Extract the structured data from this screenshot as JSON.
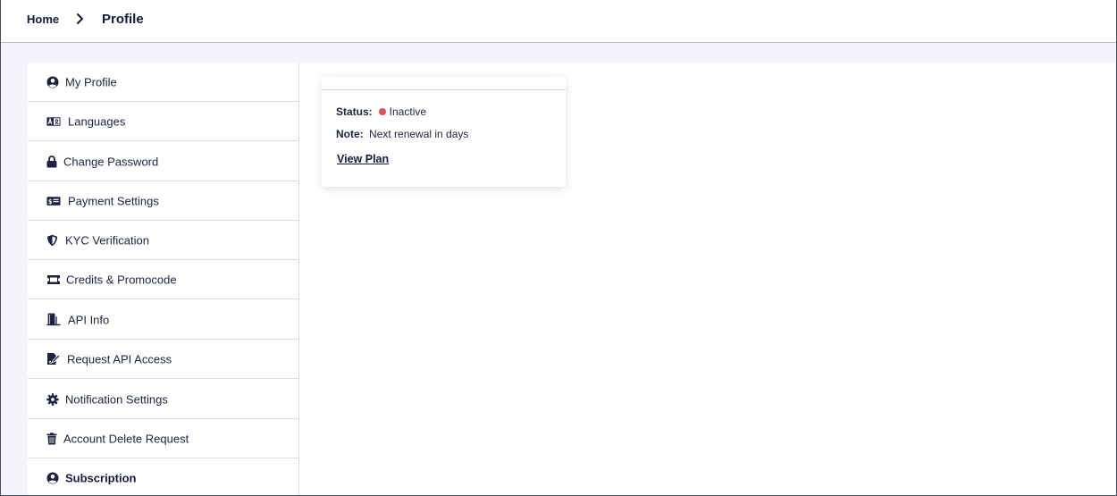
{
  "breadcrumb": {
    "home": "Home",
    "current": "Profile"
  },
  "sidebar": {
    "items": [
      {
        "label": "My Profile",
        "icon": "user-circle-icon"
      },
      {
        "label": "Languages",
        "icon": "language-icon"
      },
      {
        "label": "Change Password",
        "icon": "lock-icon"
      },
      {
        "label": "Payment Settings",
        "icon": "money-card-icon"
      },
      {
        "label": "KYC Verification",
        "icon": "shield-icon"
      },
      {
        "label": "Credits & Promocode",
        "icon": "ticket-icon"
      },
      {
        "label": "API Info",
        "icon": "door-open-icon"
      },
      {
        "label": "Request API Access",
        "icon": "edit-document-icon"
      },
      {
        "label": "Notification Settings",
        "icon": "gear-icon"
      },
      {
        "label": "Account Delete Request",
        "icon": "trash-icon"
      },
      {
        "label": "Subscription",
        "icon": "user-circle-icon",
        "active": true
      }
    ]
  },
  "subscription_card": {
    "status_label": "Status:",
    "status_value": "Inactive",
    "note_label": "Note:",
    "note_value": "Next renewal in days",
    "view_plan": "View Plan"
  },
  "colors": {
    "status_inactive": "#e0525a",
    "text_dark": "#141a3c",
    "page_bg": "#f3f4fc"
  }
}
